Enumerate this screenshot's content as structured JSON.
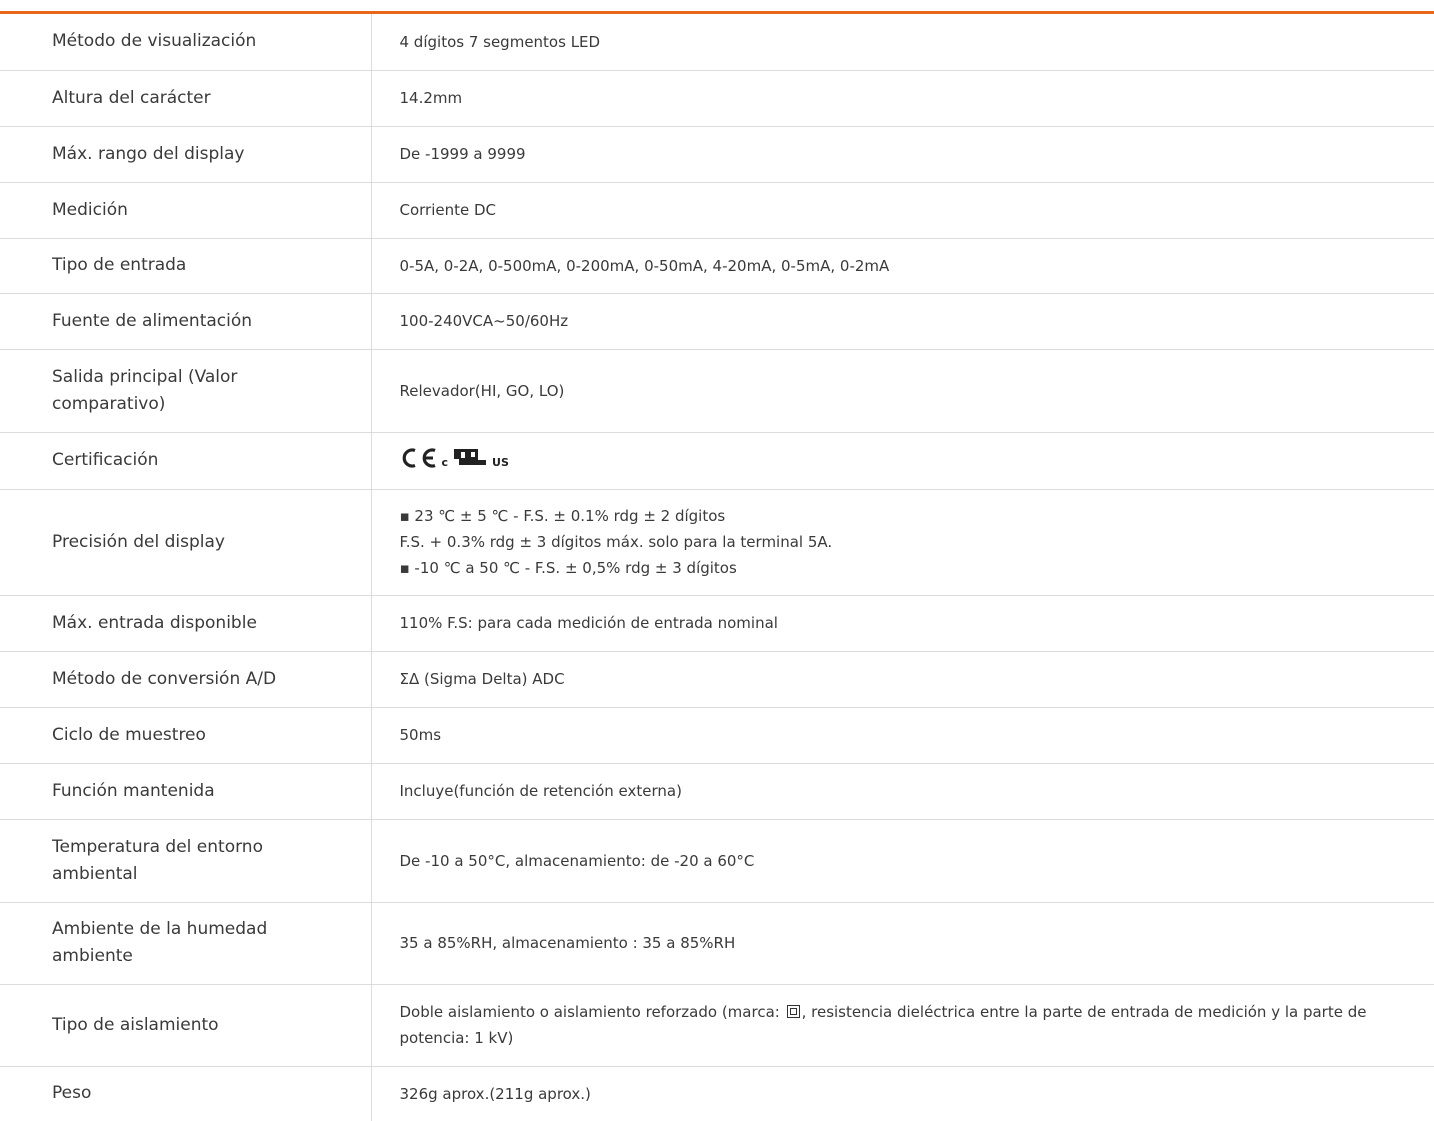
{
  "rows": [
    {
      "label": "Método de visualización",
      "value": "4 dígitos 7 segmentos LED"
    },
    {
      "label": "Altura del carácter",
      "value": "14.2mm"
    },
    {
      "label": "Máx. rango del display",
      "value": "De -1999 a 9999"
    },
    {
      "label": "Medición",
      "value": "Corriente DC"
    },
    {
      "label": "Tipo de entrada",
      "value": "0-5A, 0-2A, 0-500mA, 0-200mA, 0-50mA, 4-20mA, 0-5mA, 0-2mA"
    },
    {
      "label": "Fuente de alimentación",
      "value": "100-240VCA~50/60Hz"
    },
    {
      "label": "Salida principal (Valor comparativo)",
      "value": "Relevador(HI, GO, LO)"
    },
    {
      "label": "Certificación",
      "marks": [
        "CE",
        "cULus"
      ],
      "c_text": "c",
      "us_text": "us"
    },
    {
      "label": "Precisión del display",
      "lines": [
        "▪ 23 ℃ ± 5 ℃ - F.S. ± 0.1% rdg ± 2 dígitos",
        "F.S. + 0.3% rdg ± 3 dígitos máx. solo para la terminal 5A.",
        "▪ -10 ℃ a 50 ℃ - F.S. ± 0,5% rdg ± 3 dígitos"
      ]
    },
    {
      "label": "Máx. entrada disponible",
      "value": "110% F.S: para cada medición de entrada nominal"
    },
    {
      "label": "Método de conversión A/D",
      "value": "ΣΔ (Sigma Delta) ADC"
    },
    {
      "label": "Ciclo de muestreo",
      "value": "50ms"
    },
    {
      "label": "Función mantenida",
      "value": "Incluye(función de retención externa)"
    },
    {
      "label": "Temperatura del entorno ambiental",
      "value": "De -10 a 50°C, almacenamiento: de -20 a 60°C"
    },
    {
      "label": "Ambiente de la humedad ambiente",
      "value": "35 a 85%RH, almacenamiento : 35 a 85%RH"
    },
    {
      "label": "Tipo de aislamiento",
      "value_before": "Doble aislamiento o aislamiento reforzado (marca: ",
      "value_after": ", resistencia dieléctrica entre la parte de entrada de medición y la parte de potencia: 1 kV)"
    },
    {
      "label": "Peso",
      "value": "326g aprox.(211g aprox.)"
    }
  ],
  "colors": {
    "accent": "#e8671b",
    "border": "#dcdcdc",
    "text": "#3a3a3a"
  }
}
